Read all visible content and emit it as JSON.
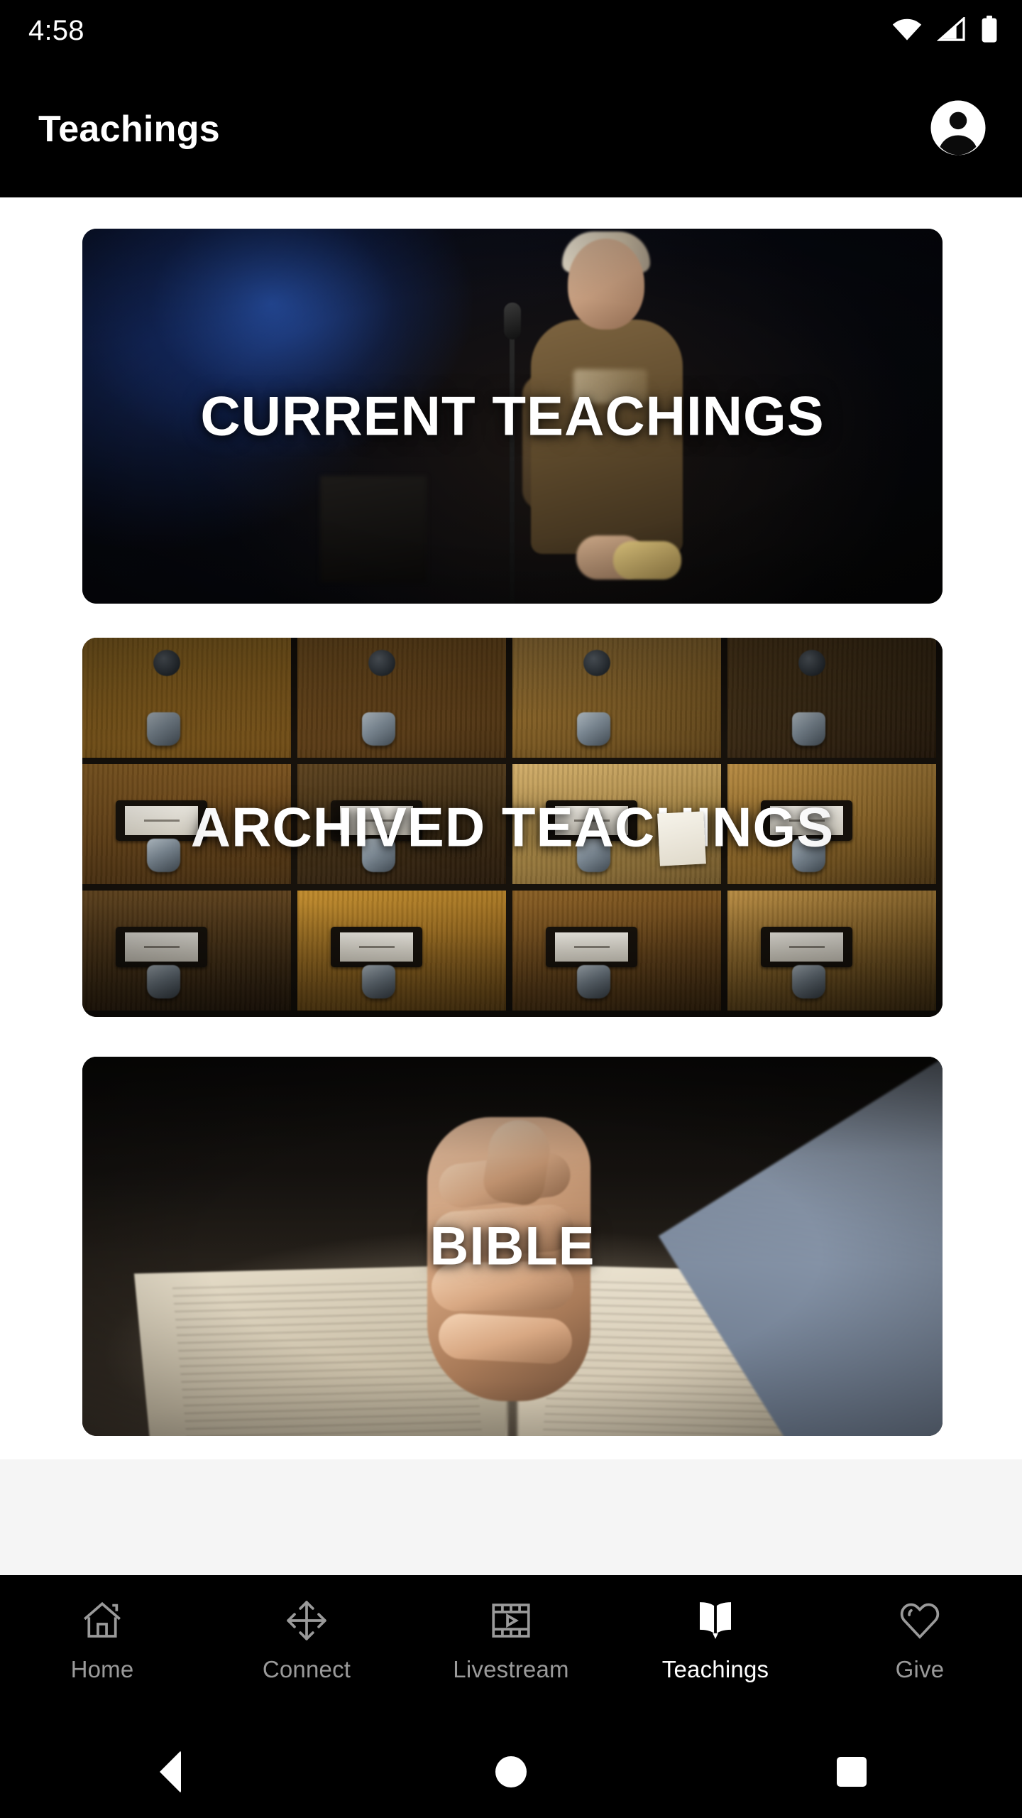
{
  "status_bar": {
    "clock": "4:58",
    "icons": [
      {
        "name": "wifi-icon",
        "label": "WiFi"
      },
      {
        "name": "cellular-signal-icon",
        "label": "Cellular signal"
      },
      {
        "name": "battery-icon",
        "label": "Battery"
      }
    ]
  },
  "app_bar": {
    "title": "Teachings",
    "account_icon": "account-circle-icon"
  },
  "content": {
    "cards": [
      {
        "label": "CURRENT TEACHINGS",
        "art": "speaker-at-microphone"
      },
      {
        "label": "ARCHIVED TEACHINGS",
        "art": "card-catalog-drawers"
      },
      {
        "label": "BIBLE",
        "art": "clasped-hands-on-bible"
      }
    ]
  },
  "bottom_nav": {
    "items": [
      {
        "label": "Home",
        "icon": "home-icon",
        "active": false
      },
      {
        "label": "Connect",
        "icon": "move-arrows-icon",
        "active": false
      },
      {
        "label": "Livestream",
        "icon": "film-play-icon",
        "active": false
      },
      {
        "label": "Teachings",
        "icon": "open-book-icon",
        "active": true
      },
      {
        "label": "Give",
        "icon": "heart-icon",
        "active": false
      }
    ]
  },
  "system_nav": {
    "back": "back-triangle-icon",
    "home": "home-circle-icon",
    "recents": "recents-square-icon"
  },
  "colors": {
    "bar_background": "#000000",
    "content_background": "#ffffff",
    "filler_background": "#f5f5f5",
    "nav_inactive": "#9a9a9a",
    "nav_active": "#ffffff"
  }
}
